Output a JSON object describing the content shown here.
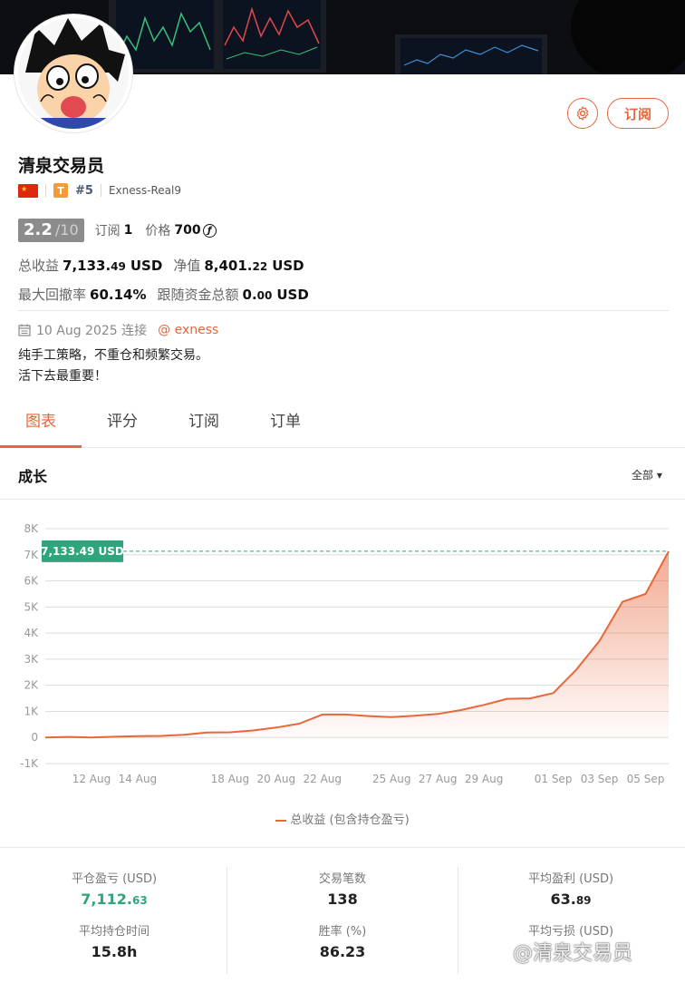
{
  "profile": {
    "name": "清泉交易员",
    "flag_star": "★",
    "tier_badge": "T",
    "rank": "#5",
    "server": "Exness-Real9",
    "score": "2.2",
    "score_max": "/10",
    "subscribe_label": "订阅",
    "subscribers_label": "订阅",
    "subscribers": "1",
    "price_label": "价格",
    "price": "700",
    "price_coin": "ƒ",
    "total_profit_label": "总收益",
    "total_profit_int": "7,133.",
    "total_profit_dec": "49",
    "unit": "USD",
    "equity_label": "净值",
    "equity_int": "8,401.",
    "equity_dec": "22",
    "drawdown_label": "最大回撤率",
    "drawdown": "60.14%",
    "follow_label": "跟随资金总额",
    "follow_int": "0.",
    "follow_dec": "00",
    "since": "10 Aug 2025 连接",
    "broker": "@ exness",
    "bio_line1": "纯手工策略，不重仓和频繁交易。",
    "bio_line2": "活下去最重要！"
  },
  "tabs": [
    "图表",
    "评分",
    "订阅",
    "订单"
  ],
  "section": {
    "title": "成长",
    "range": "全部 ▾"
  },
  "chart_data": {
    "type": "area",
    "x": [
      "10 Aug",
      "11 Aug",
      "12 Aug",
      "13 Aug",
      "14 Aug",
      "15 Aug",
      "16 Aug",
      "17 Aug",
      "18 Aug",
      "19 Aug",
      "20 Aug",
      "21 Aug",
      "22 Aug",
      "23 Aug",
      "24 Aug",
      "25 Aug",
      "26 Aug",
      "27 Aug",
      "28 Aug",
      "29 Aug",
      "30 Aug",
      "31 Aug",
      "01 Sep",
      "02 Sep",
      "03 Sep",
      "04 Sep",
      "05 Sep",
      "06 Sep"
    ],
    "xticks": [
      "12 Aug",
      "14 Aug",
      "18 Aug",
      "20 Aug",
      "22 Aug",
      "25 Aug",
      "27 Aug",
      "29 Aug",
      "01 Sep",
      "03 Sep",
      "05 Sep"
    ],
    "series": [
      {
        "name": "总收益 (包含持仓盈亏)",
        "values": [
          0,
          20,
          0,
          30,
          50,
          60,
          100,
          190,
          200,
          270,
          380,
          530,
          880,
          880,
          820,
          780,
          830,
          900,
          1050,
          1250,
          1480,
          1500,
          1700,
          2600,
          3700,
          5200,
          5500,
          7133.49
        ]
      }
    ],
    "yticks": [
      "8K",
      "7K",
      "6K",
      "5K",
      "4K",
      "3K",
      "2K",
      "1K",
      "0",
      "-1K"
    ],
    "ylim": [
      -1000,
      8000
    ],
    "current_label": "7,133.49 USD",
    "current_value": 7133.49,
    "color": "#e8663a",
    "grid": true,
    "legend_position": "bottom"
  },
  "stats": {
    "closed_pl_label": "平仓盈亏 (USD)",
    "closed_pl_int": "7,112.",
    "closed_pl_dec": "63",
    "trades_label": "交易笔数",
    "trades": "138",
    "avg_profit_label": "平均盈利 (USD)",
    "avg_profit_int": "63.",
    "avg_profit_dec": "89",
    "avg_hold_label": "平均持仓时间",
    "avg_hold": "15.8h",
    "winrate_label": "胜率 (%)",
    "winrate": "86.23",
    "avg_loss_label": "平均亏损 (USD)"
  },
  "watermark": "@清泉交易员",
  "colors": {
    "accent": "#e8663a",
    "positive": "#2ea57b",
    "badge": "#f29c38"
  }
}
